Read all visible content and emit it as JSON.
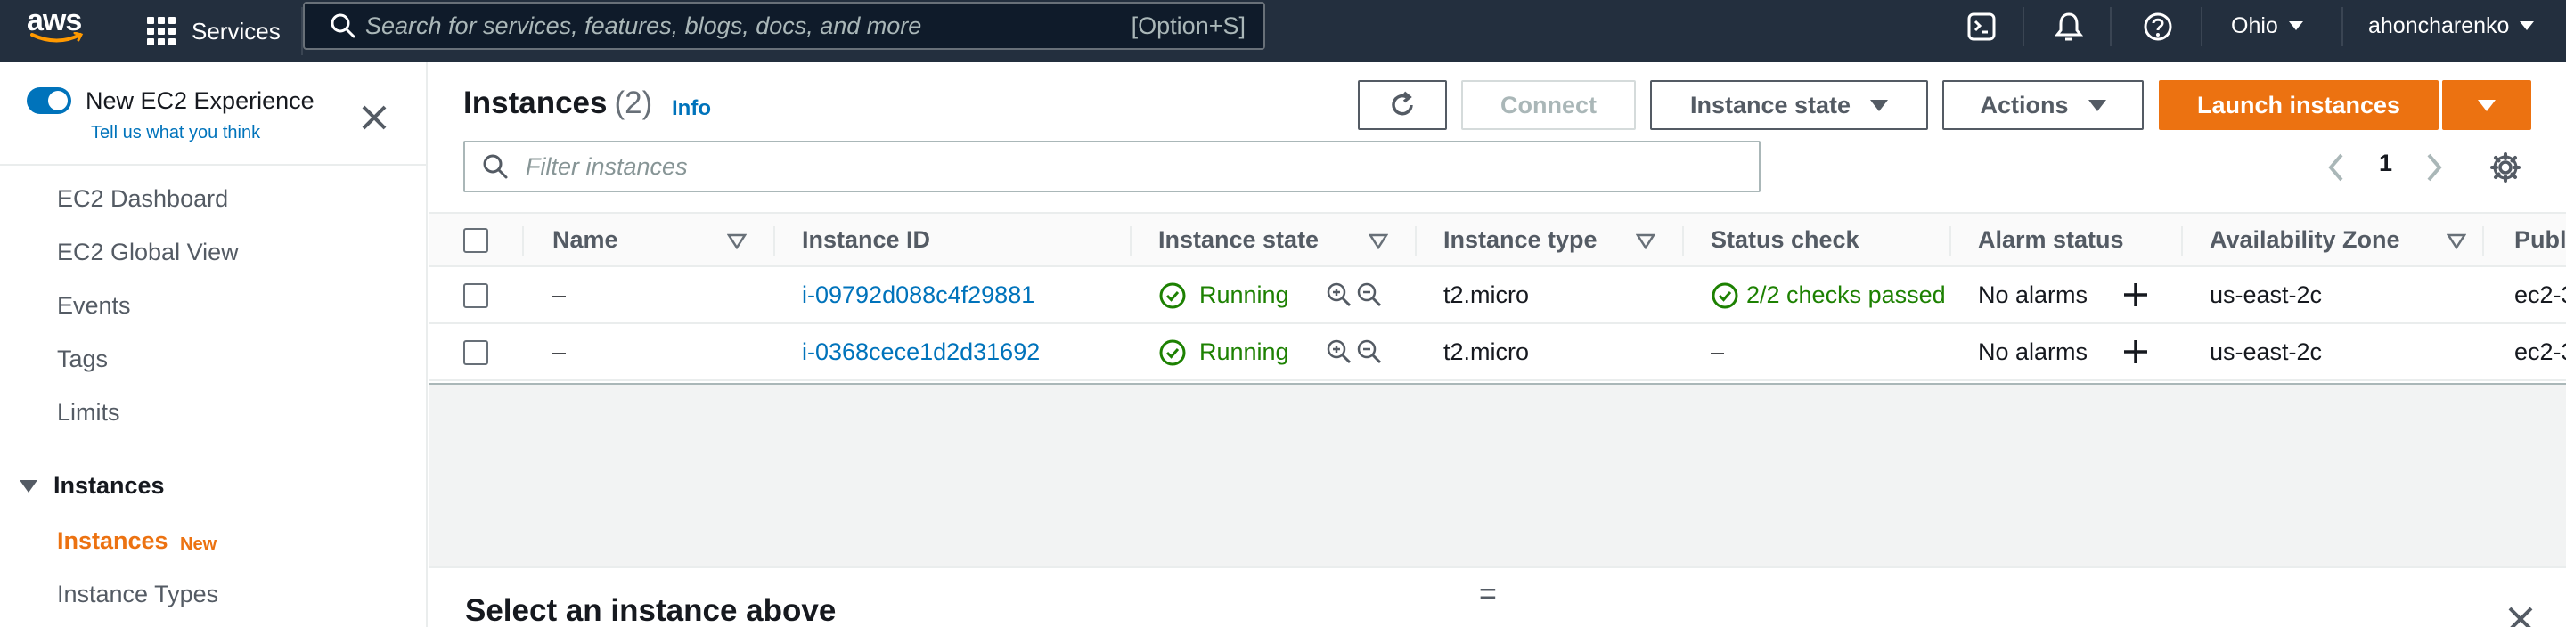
{
  "topnav": {
    "logo_text": "aws",
    "services_label": "Services",
    "search_placeholder": "Search for services, features, blogs, docs, and more",
    "search_shortcut": "[Option+S]",
    "region": "Ohio",
    "user": "ahoncharenko"
  },
  "sidebar": {
    "experience_label": "New EC2 Experience",
    "feedback_link": "Tell us what you think",
    "items": [
      "EC2 Dashboard",
      "EC2 Global View",
      "Events",
      "Tags",
      "Limits"
    ],
    "section_label": "Instances",
    "active_item": "Instances",
    "active_badge": "New",
    "next_item": "Instance Types"
  },
  "panel": {
    "title": "Instances",
    "count": "(2)",
    "info_label": "Info",
    "connect_label": "Connect",
    "instance_state_label": "Instance state",
    "actions_label": "Actions",
    "launch_label": "Launch instances",
    "filter_placeholder": "Filter instances",
    "page_number": "1"
  },
  "table": {
    "columns": [
      "Name",
      "Instance ID",
      "Instance state",
      "Instance type",
      "Status check",
      "Alarm status",
      "Availability Zone",
      "Publ"
    ],
    "rows": [
      {
        "name": "–",
        "instance_id": "i-09792d088c4f29881",
        "state": "Running",
        "type": "t2.micro",
        "status_check": "2/2 checks passed",
        "alarm": "No alarms",
        "zone": "us-east-2c",
        "public": "ec2-3"
      },
      {
        "name": "–",
        "instance_id": "i-0368cece1d2d31692",
        "state": "Running",
        "type": "t2.micro",
        "status_check": "–",
        "alarm": "No alarms",
        "zone": "us-east-2c",
        "public": "ec2-3"
      }
    ]
  },
  "details": {
    "title": "Select an instance above",
    "resize_glyph": "="
  },
  "colors": {
    "nav_bg": "#232f3e",
    "accent_orange": "#ec7211",
    "link_blue": "#0073bb",
    "success_green": "#1d8102"
  }
}
